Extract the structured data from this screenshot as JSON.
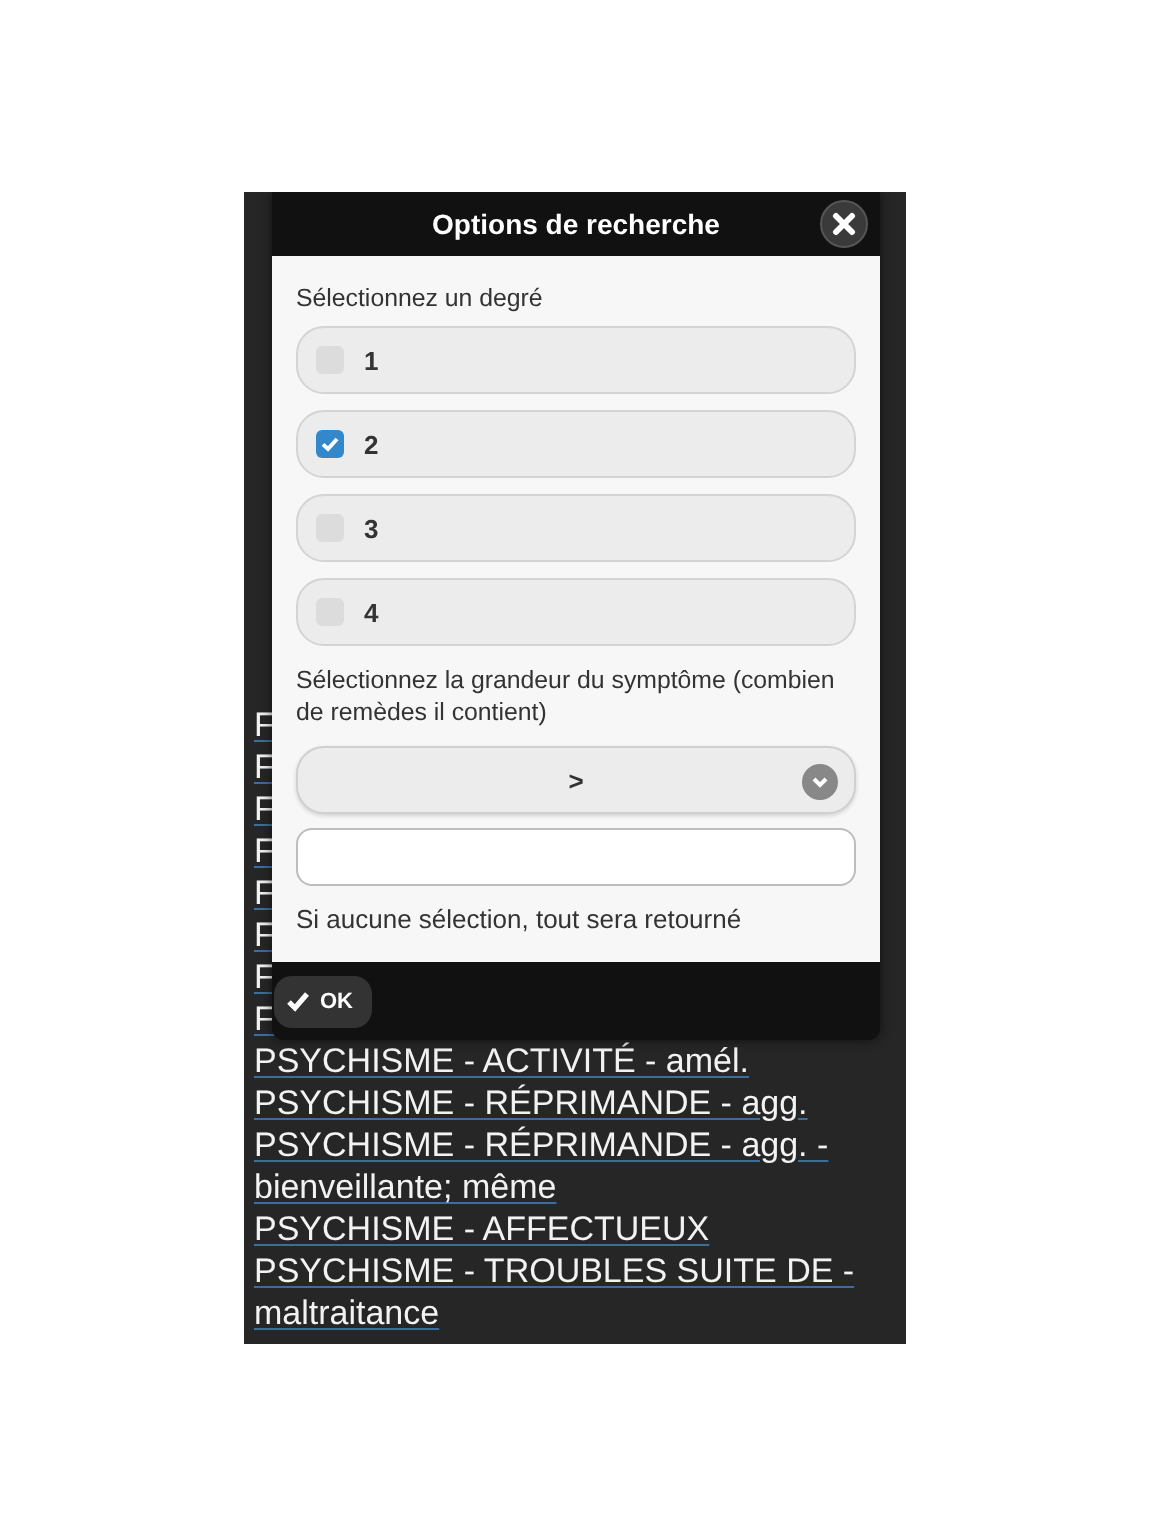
{
  "background_links": [
    {
      "text": "F"
    },
    {
      "text": "F"
    },
    {
      "text": "F"
    },
    {
      "text": "F"
    },
    {
      "text": "F"
    },
    {
      "text": "F"
    },
    {
      "text": "F"
    },
    {
      "text": "F"
    },
    {
      "text": "PSYCHISME - ACTIVITÉ - amél."
    },
    {
      "text": "PSYCHISME - RÉPRIMANDE - agg."
    },
    {
      "text": "PSYCHISME - RÉPRIMANDE - agg. - bienveillante; même"
    },
    {
      "text": "PSYCHISME - AFFECTUEUX"
    },
    {
      "text": "PSYCHISME - TROUBLES SUITE DE - maltraitance"
    }
  ],
  "dialog": {
    "title": "Options de recherche",
    "degree_label": "Sélectionnez un degré",
    "degrees": [
      {
        "label": "1",
        "checked": false
      },
      {
        "label": "2",
        "checked": true
      },
      {
        "label": "3",
        "checked": false
      },
      {
        "label": "4",
        "checked": false
      }
    ],
    "size_label": "Sélectionnez la grandeur du symptôme (combien de remèdes il contient)",
    "select": {
      "value": ">"
    },
    "hint": "Si aucune sélection, tout sera retourné",
    "ok_button": {
      "label": "OK"
    }
  }
}
